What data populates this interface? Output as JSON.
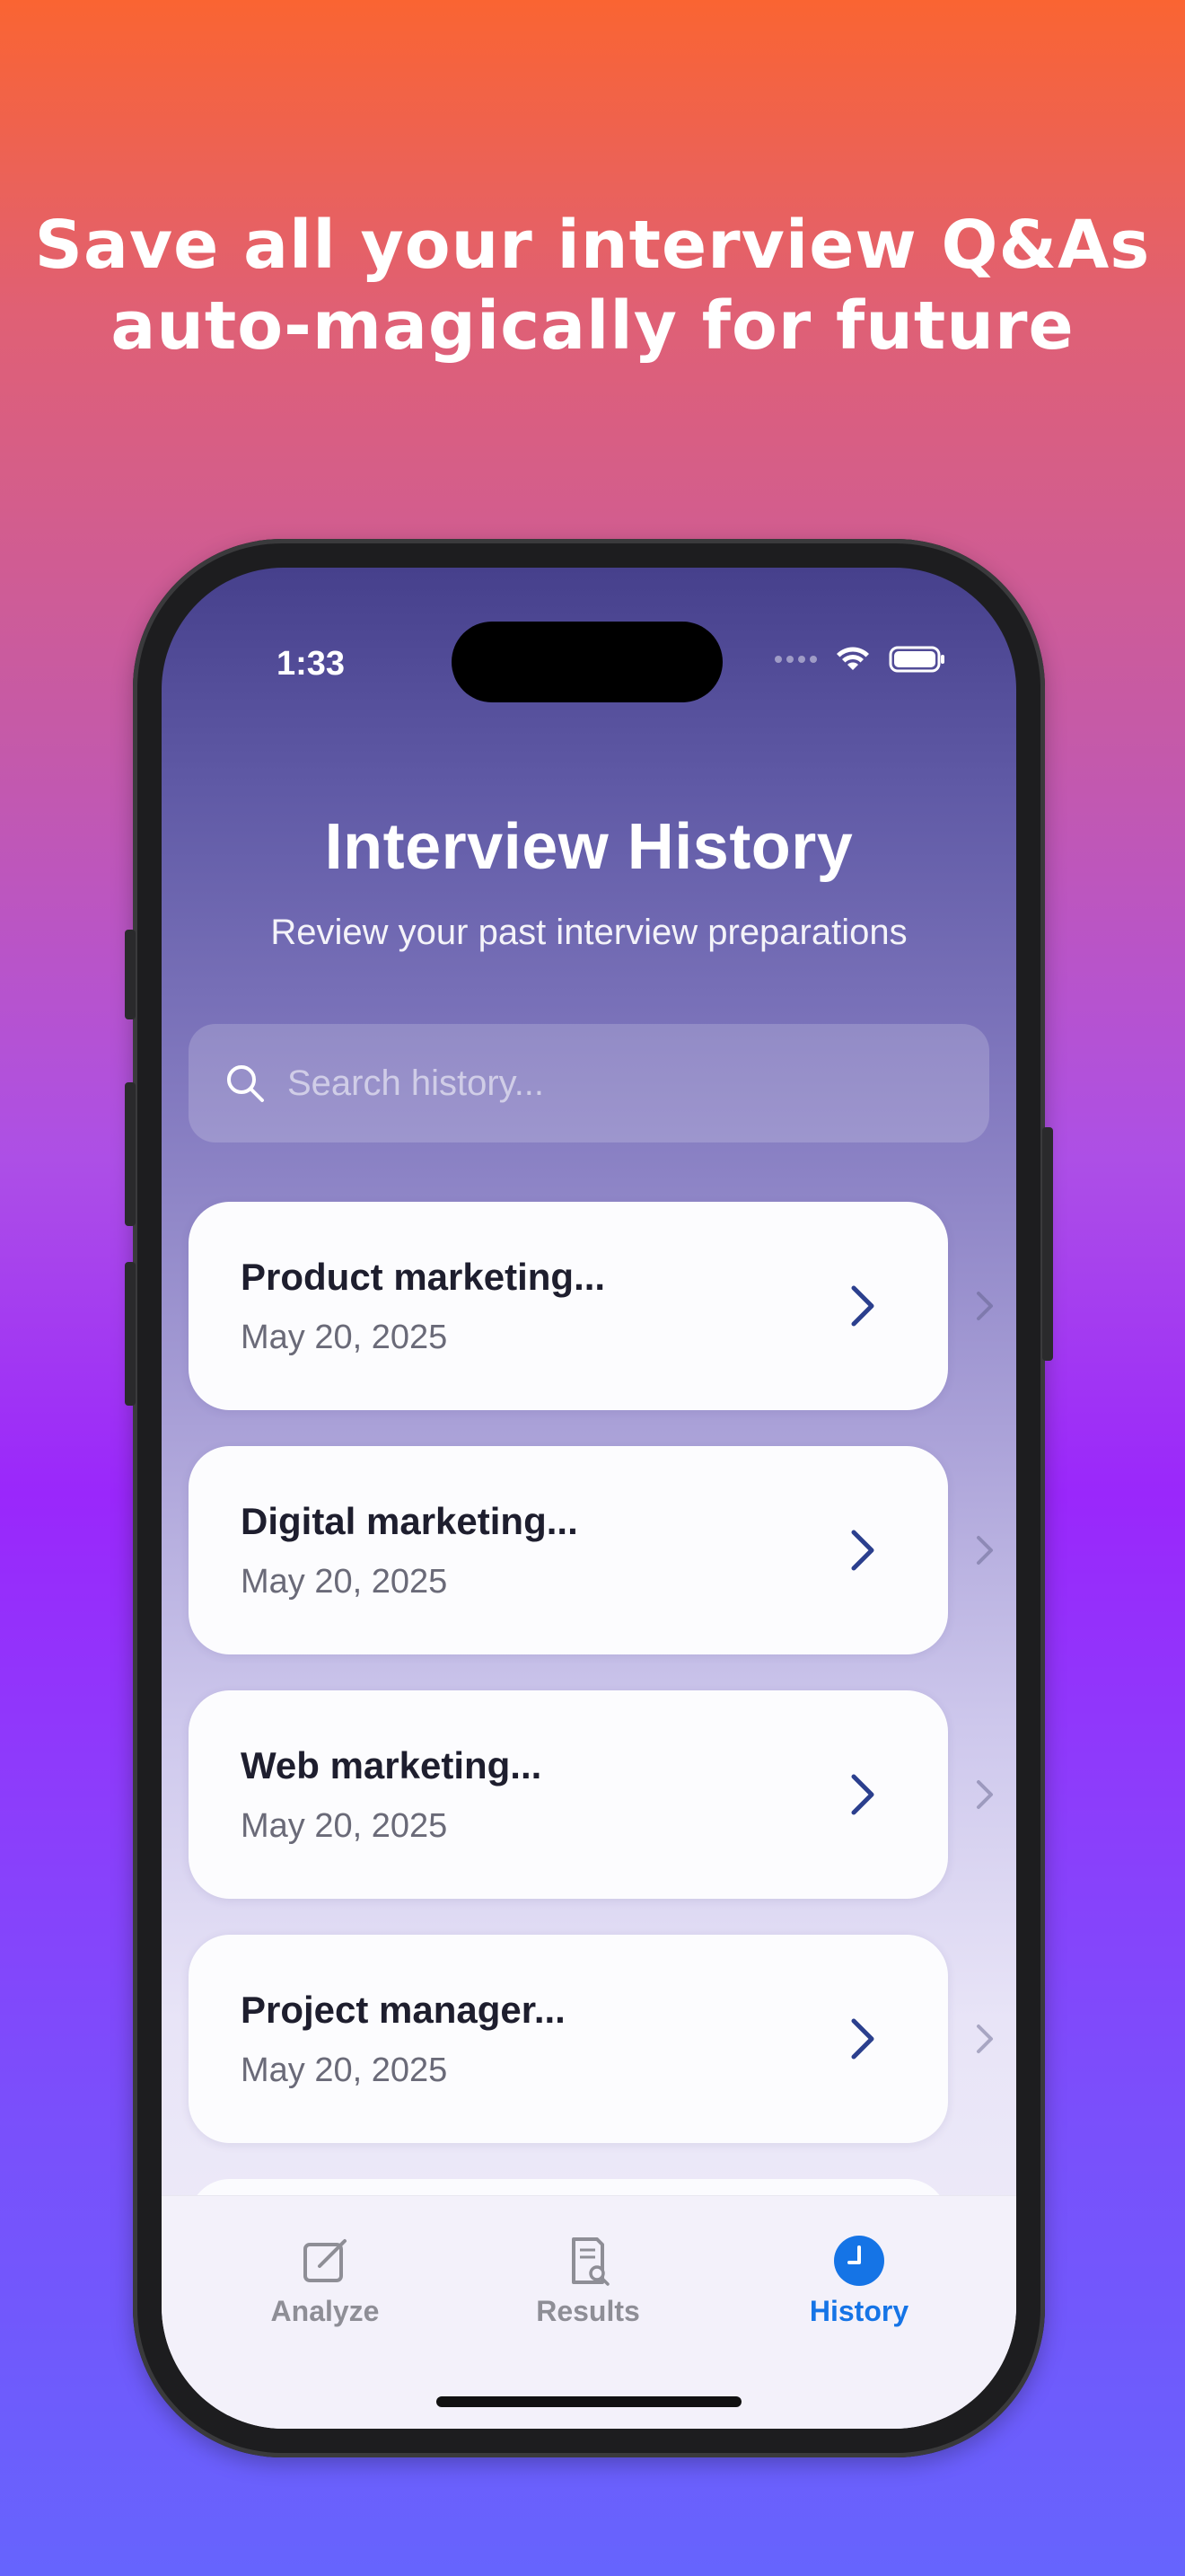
{
  "headline": {
    "line1": "Save all your interview Q&As",
    "line2": "auto-magically for future"
  },
  "status_bar": {
    "time": "1:33"
  },
  "header": {
    "title": "Interview History",
    "subtitle": "Review your past interview preparations"
  },
  "search": {
    "placeholder": "Search history...",
    "value": ""
  },
  "history": [
    {
      "title": "Product marketing...",
      "date": "May 20, 2025"
    },
    {
      "title": "Digital marketing...",
      "date": "May 20, 2025"
    },
    {
      "title": "Web marketing...",
      "date": "May 20, 2025"
    },
    {
      "title": "Project manager...",
      "date": "May 20, 2025"
    }
  ],
  "tabs": [
    {
      "label": "Analyze",
      "icon": "edit-icon",
      "active": false
    },
    {
      "label": "Results",
      "icon": "document-search-icon",
      "active": false
    },
    {
      "label": "History",
      "icon": "clock-icon",
      "active": true
    }
  ],
  "colors": {
    "accent": "#1574e6",
    "chevron": "#2b3f8e",
    "card_title": "#1e1e2e",
    "card_date": "#6a6a78"
  }
}
